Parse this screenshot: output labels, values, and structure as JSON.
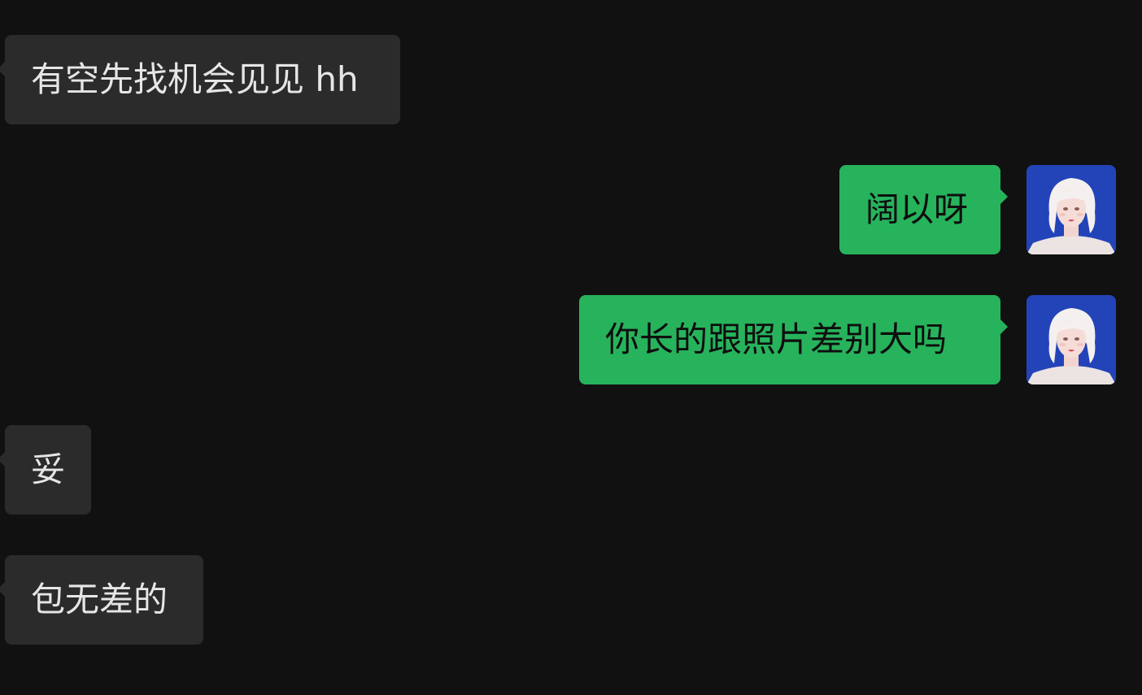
{
  "conversation": {
    "messages": [
      {
        "sender": "other",
        "text": "有空先找机会见见 hh"
      },
      {
        "sender": "self",
        "text": "阔以呀",
        "avatar_icon": "user-avatar-illustration-icon"
      },
      {
        "sender": "self",
        "text": "你长的跟照片差别大吗",
        "avatar_icon": "user-avatar-illustration-icon"
      },
      {
        "sender": "other",
        "text": "妥"
      },
      {
        "sender": "other",
        "text": "包无差的"
      }
    ]
  },
  "colors": {
    "background": "#111111",
    "incoming_bubble": "#2b2b2b",
    "incoming_text": "#e6e6e6",
    "outgoing_bubble": "#27b35c",
    "outgoing_text": "#0e0e0e",
    "avatar_background": "#2344b8"
  }
}
